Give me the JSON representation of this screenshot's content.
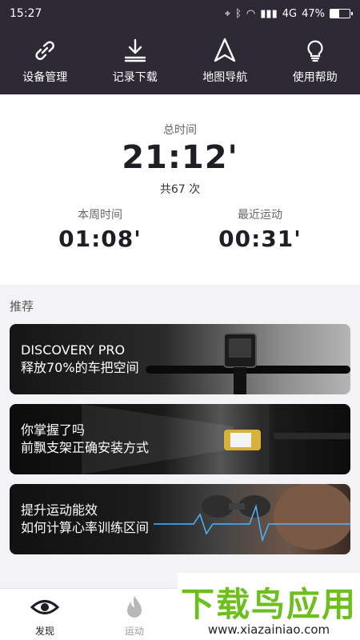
{
  "status": {
    "time": "15:27",
    "network": "4G",
    "battery": "47%",
    "battery_level": 0.47
  },
  "topnav": [
    {
      "label": "设备管理",
      "icon": "link-icon"
    },
    {
      "label": "记录下载",
      "icon": "download-icon"
    },
    {
      "label": "地图导航",
      "icon": "navigation-arrow-icon"
    },
    {
      "label": "使用帮助",
      "icon": "lightbulb-icon"
    }
  ],
  "stats": {
    "total_label": "总时间",
    "total_value": "21:12'",
    "total_count": "共67 次",
    "week_label": "本周时间",
    "week_value": "01:08'",
    "recent_label": "最近运动",
    "recent_value": "00:31'"
  },
  "recommend": {
    "title": "推荐",
    "cards": [
      {
        "line1": "DISCOVERY PRO",
        "line2": "释放70%的车把空间"
      },
      {
        "line1": "你掌握了吗",
        "line2": "前飘支架正确安装方式"
      },
      {
        "line1": "提升运动能效",
        "line2": "如何计算心率训练区间"
      }
    ]
  },
  "tabs": [
    {
      "label": "发现",
      "icon": "eye-icon"
    },
    {
      "label": "运动",
      "icon": "flame-icon"
    }
  ],
  "watermark": {
    "text": "下载鸟应用",
    "url": "www.xiazainiao.com"
  },
  "colors": {
    "header_bg": "#2d2935",
    "watermark_green": "#6cbf1c"
  }
}
